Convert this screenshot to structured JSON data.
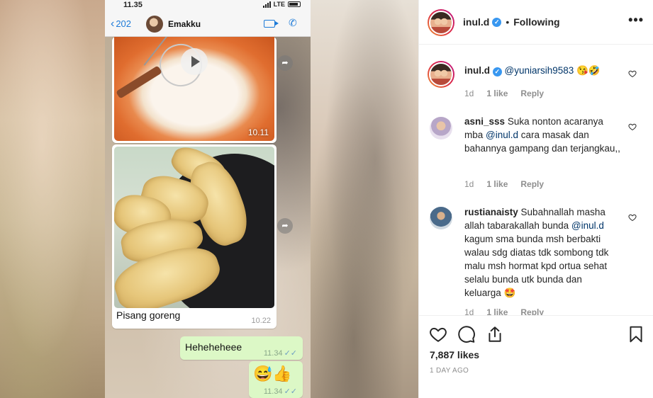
{
  "phone": {
    "status_time": "11.35",
    "network": "LTE",
    "back_count": "202",
    "contact_name": "Emakku",
    "video_time_1": "10.11",
    "caption": "Pisang goreng",
    "caption_time": "10.22",
    "reply_text": "Heheheheee",
    "reply_time": "11.34",
    "reply2_emoji": "😅👍",
    "reply2_time": "11.34"
  },
  "post": {
    "username": "inul.d",
    "follow_status": "Following",
    "more_label": "•••"
  },
  "comments": [
    {
      "username": "inul.d",
      "verified": true,
      "text_before": "",
      "mention": "@yuniarsih9583",
      "text_after": " 😘🤣",
      "age": "1d",
      "likes": "1 like",
      "reply": "Reply"
    },
    {
      "username": "asni_sss",
      "text_before": "Suka nonton acaranya mba ",
      "mention": "@inul.d",
      "text_after": " cara masak dan bahannya gampang dan terjangkau,,",
      "age": "1d",
      "likes": "1 like",
      "reply": "Reply"
    },
    {
      "username": "rustianaisty",
      "text_before": "Subahnallah masha allah tabarakallah bunda ",
      "mention": "@inul.d",
      "text_after": " kagum sma bunda msh berbakti walau sdg diatas tdk sombong tdk malu msh hormat kpd ortua sehat selalu bunda utk bunda dan keluarga 🤩",
      "age": "1d",
      "likes": "1 like",
      "reply": "Reply"
    }
  ],
  "actions": {
    "likes": "7,887 likes",
    "time_ago": "1 DAY AGO"
  },
  "icons": [
    "heart-icon",
    "comment-icon",
    "share-icon",
    "bookmark-icon",
    "verified-badge-icon",
    "more-options-icon",
    "video-call-icon",
    "phone-call-icon",
    "forward-icon",
    "play-icon",
    "read-ticks-icon"
  ]
}
